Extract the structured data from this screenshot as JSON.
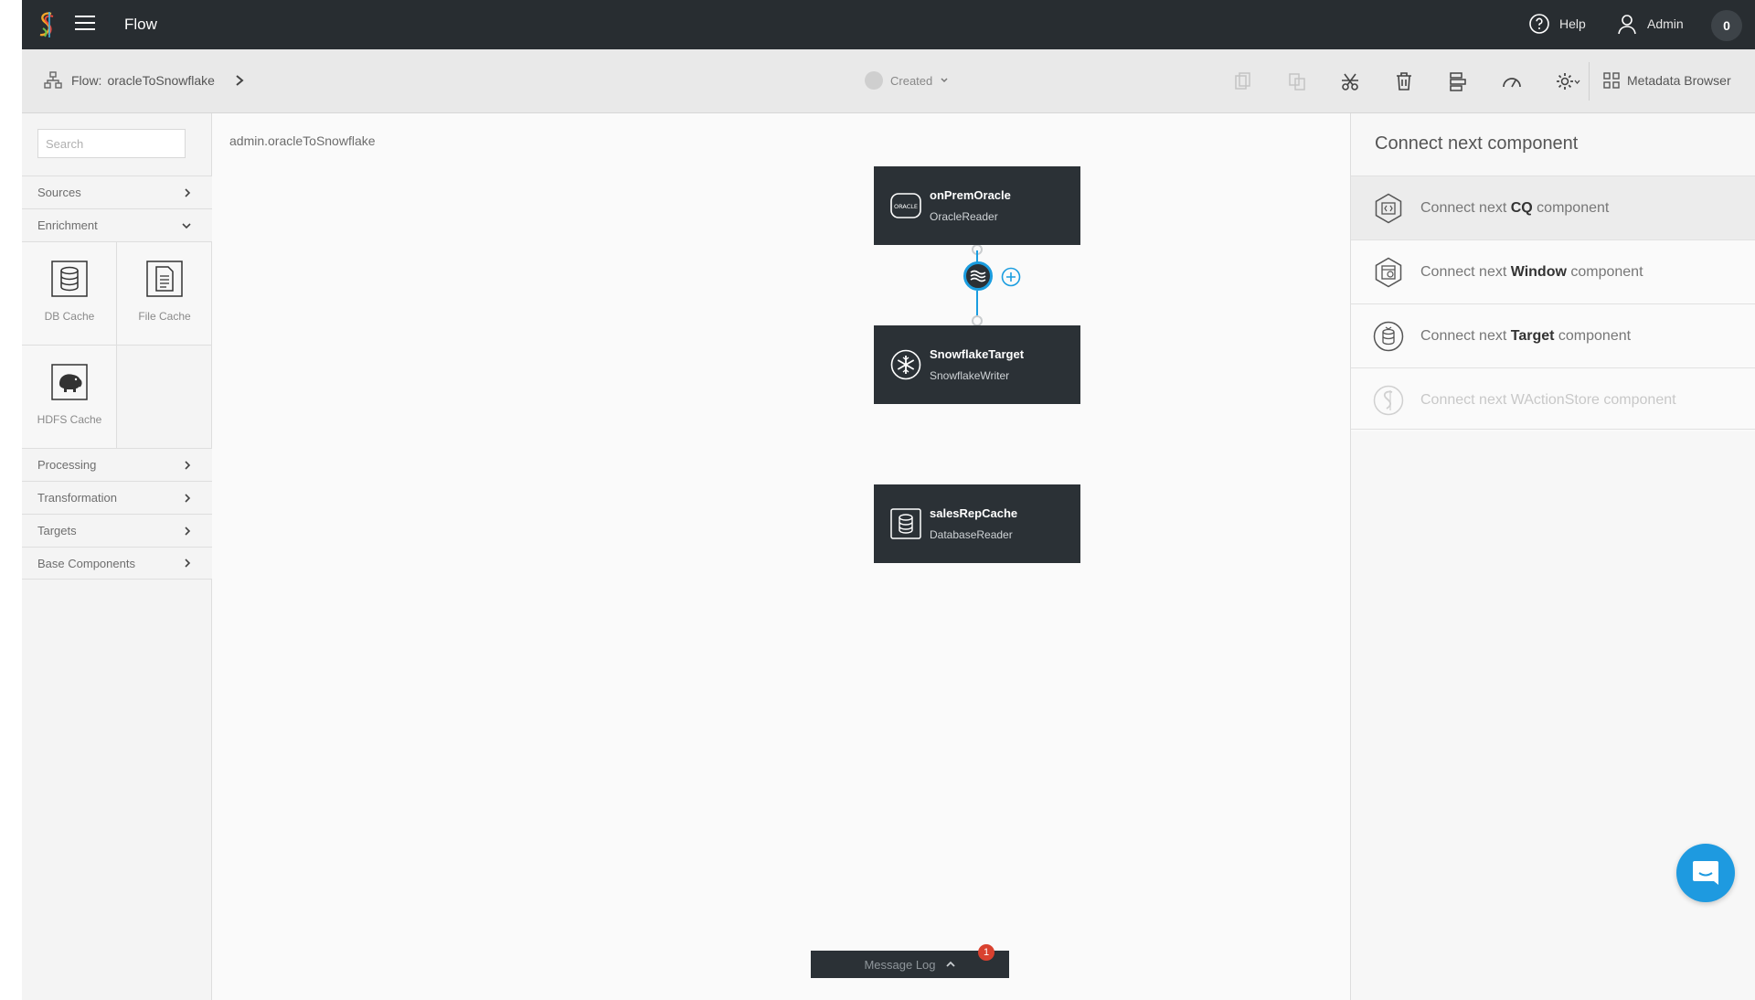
{
  "topbar": {
    "app_title": "Flow",
    "help_label": "Help",
    "admin_label": "Admin",
    "notification_count": "0"
  },
  "subbar": {
    "flow_prefix": "Flow:",
    "flow_name": "oracleToSnowflake",
    "status": "Created",
    "metadata_browser_label": "Metadata Browser",
    "tool_icons": [
      "copy-icon",
      "paste-icon",
      "cut-icon",
      "delete-icon",
      "layout-icon",
      "monitor-gauge-icon",
      "settings-icon"
    ]
  },
  "palette": {
    "search_placeholder": "Search",
    "categories": {
      "sources": "Sources",
      "enrichment": "Enrichment",
      "processing": "Processing",
      "transformation": "Transformation",
      "targets": "Targets",
      "base_components": "Base Components"
    },
    "enrichment_items": [
      {
        "label": "DB Cache",
        "icon": "database-icon"
      },
      {
        "label": "File Cache",
        "icon": "file-icon"
      },
      {
        "label": "HDFS Cache",
        "icon": "hadoop-elephant-icon"
      }
    ]
  },
  "canvas": {
    "namespace": "admin.oracleToSnowflake",
    "nodes": [
      {
        "name": "onPremOracle",
        "type": "OracleReader",
        "icon": "oracle-icon"
      },
      {
        "name": "SnowflakeTarget",
        "type": "SnowflakeWriter",
        "icon": "snowflake-icon"
      },
      {
        "name": "salesRepCache",
        "type": "DatabaseReader",
        "icon": "database-icon"
      }
    ],
    "message_log_label": "Message Log",
    "message_log_count": "1"
  },
  "right_panel": {
    "title": "Connect next component",
    "items": [
      {
        "prefix": "Connect next ",
        "bold": "CQ",
        "suffix": " component",
        "icon": "cq-icon"
      },
      {
        "prefix": "Connect next ",
        "bold": "Window",
        "suffix": " component",
        "icon": "window-icon"
      },
      {
        "prefix": "Connect next ",
        "bold": "Target",
        "suffix": " component",
        "icon": "target-icon"
      },
      {
        "prefix": "Connect next WActionStore component",
        "bold": "",
        "suffix": "",
        "icon": "waction-store-icon"
      }
    ]
  },
  "colors": {
    "topbar": "#282d31",
    "node": "#2b3136",
    "accent": "#1a9de0",
    "badge": "#d9412f"
  }
}
